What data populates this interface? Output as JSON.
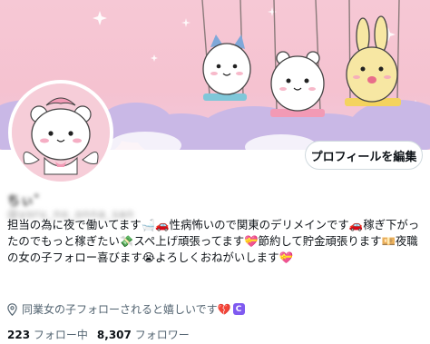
{
  "profile": {
    "name": "ちぃ゛",
    "handle": "@yoru_no_onna_san",
    "edit_button_label": "プロフィールを編集",
    "bio_lines": [
      "担当の為に夜で働いてます🛁🚗性病怖いので関東のデリメインです🚗稼ぎ下がっ",
      "たのでもっと稼ぎたい💸スペ上げ頑張ってます💝節約して貯金頑張ります💴夜職",
      "の女の子フォロー喜びます😭よろしくおねがいします💝"
    ],
    "location_text": "同業女の子フォローされると嬉しいです💔",
    "location_badge": "C",
    "stats": {
      "following_count": "223",
      "following_label": "フォロー中",
      "followers_count": "8,307",
      "followers_label": "フォロワー"
    }
  },
  "colors": {
    "banner_pink": "#f5c2d0",
    "cloud_lavender": "#c9b8e6",
    "border": "#cfd9de",
    "muted_text": "#536471",
    "badge_purple": "#7f5af0"
  }
}
